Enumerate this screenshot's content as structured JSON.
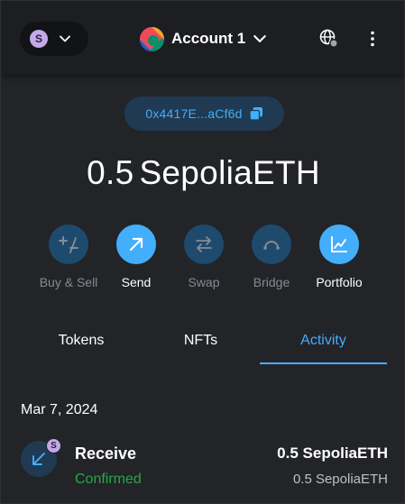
{
  "header": {
    "network_avatar_letter": "S",
    "account_name": "Account 1",
    "icons": [
      "chevron-down-icon",
      "globe-icon",
      "kebab-menu-icon"
    ]
  },
  "address": {
    "short": "0x4417E...aCf6d",
    "icon": "copy-icon"
  },
  "balance": {
    "amount": "0.5",
    "symbol": "SepoliaETH"
  },
  "actions": [
    {
      "label": "Buy & Sell",
      "icon": "plus-minus-icon",
      "enabled": false
    },
    {
      "label": "Send",
      "icon": "arrow-up-right-icon",
      "enabled": true
    },
    {
      "label": "Swap",
      "icon": "swap-arrows-icon",
      "enabled": false
    },
    {
      "label": "Bridge",
      "icon": "bridge-icon",
      "enabled": false
    },
    {
      "label": "Portfolio",
      "icon": "chart-icon",
      "enabled": true
    }
  ],
  "tabs": [
    {
      "label": "Tokens",
      "active": false
    },
    {
      "label": "NFTs",
      "active": false
    },
    {
      "label": "Activity",
      "active": true
    }
  ],
  "activity": {
    "date": "Mar 7, 2024",
    "items": [
      {
        "title": "Receive",
        "status": "Confirmed",
        "amount": "0.5 SepoliaETH",
        "secondary_amount": "0.5 SepoliaETH",
        "badge_letter": "S",
        "icon": "arrow-down-left-icon"
      }
    ]
  },
  "colors": {
    "accent": "#43aefc",
    "background": "#222428",
    "success": "#28a745",
    "muted_text": "#878b92"
  }
}
